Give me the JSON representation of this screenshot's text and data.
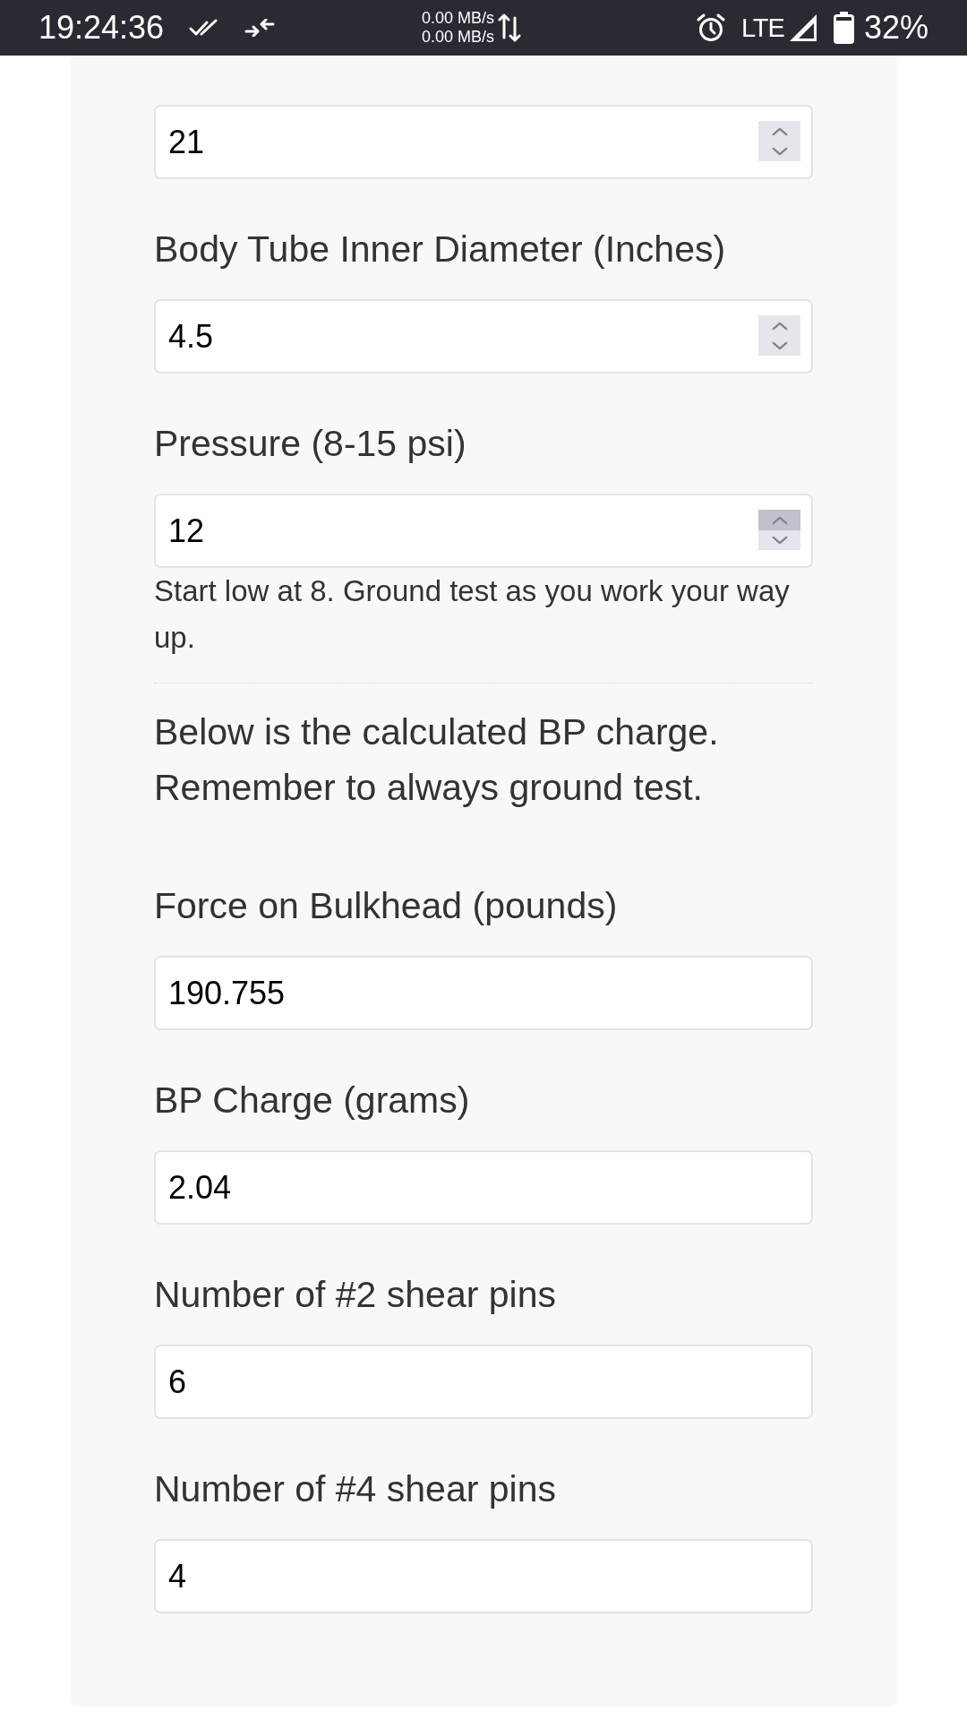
{
  "status_bar": {
    "time": "19:24:36",
    "upload_speed": "0.00 MB/s",
    "download_speed": "0.00 MB/s",
    "network_type": "LTE",
    "battery": "32%"
  },
  "form": {
    "inputs": [
      {
        "kind": "number",
        "value": "21",
        "spinner_up_active": false
      },
      {
        "kind": "number",
        "label": "Body Tube Inner Diameter (Inches)",
        "value": "4.5",
        "spinner_up_active": false
      },
      {
        "kind": "number",
        "label": "Pressure (8-15 psi)",
        "value": "12",
        "spinner_up_active": true,
        "hint": "Start low at 8. Ground test as you work your way up."
      }
    ],
    "note": "Below is the calculated BP charge. Remember to always ground test.",
    "results": [
      {
        "kind": "text",
        "label": "Force on Bulkhead (pounds)",
        "value": "190.755"
      },
      {
        "kind": "text",
        "label": "BP Charge (grams)",
        "value": "2.04"
      },
      {
        "kind": "text",
        "label": "Number of #2 shear pins",
        "value": "6"
      },
      {
        "kind": "text",
        "label": "Number of #4 shear pins",
        "value": "4"
      }
    ]
  }
}
